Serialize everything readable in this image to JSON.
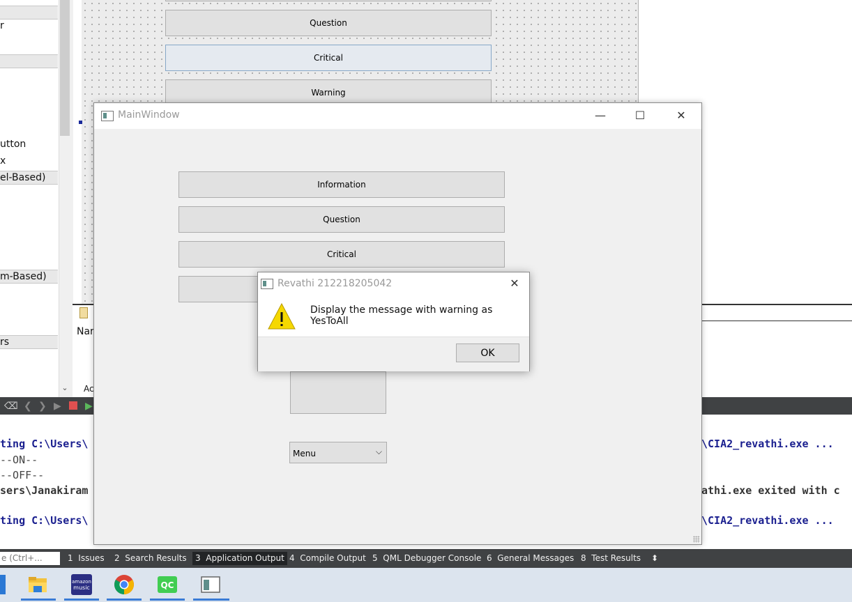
{
  "sidebar": {
    "line1": "r",
    "item_button": "utton",
    "item_x": "x",
    "category_item_based": "el-Based)",
    "category_item_model": "m-Based)",
    "category_containers": "rs"
  },
  "designer": {
    "buttons": [
      "Question",
      "Critical",
      "Warning"
    ]
  },
  "left_panel": {
    "name_label": "Nar",
    "ad_label": "Ac"
  },
  "console": {
    "lines": [
      "ting C:\\Users\\",
      "--ON--",
      "--OFF--",
      "sers\\Janakiram",
      "ting C:\\Users\\"
    ],
    "right_lines": [
      "\\CIA2_revathi.exe ...",
      "athi.exe exited with c",
      "\\CIA2_revathi.exe ..."
    ]
  },
  "statusbar": {
    "search_placeholder": "e (Ctrl+...",
    "tabs": [
      {
        "num": "1",
        "label": "Issues"
      },
      {
        "num": "2",
        "label": "Search Results"
      },
      {
        "num": "3",
        "label": "Application Output"
      },
      {
        "num": "4",
        "label": "Compile Output"
      },
      {
        "num": "5",
        "label": "QML Debugger Console"
      },
      {
        "num": "6",
        "label": "General Messages"
      },
      {
        "num": "8",
        "label": "Test Results"
      }
    ],
    "active_tab": 2,
    "arrows": "⬍"
  },
  "mainwindow": {
    "title": "MainWindow",
    "minimize": "—",
    "maximize": "☐",
    "close": "✕",
    "buttons": [
      "Information",
      "Question",
      "Critical"
    ],
    "combo_value": "Menu",
    "combo_arrow": "⌵"
  },
  "dialog": {
    "title": "Revathi 212218205042",
    "close": "✕",
    "message": "Display the message with warning as YesToAll",
    "ok_label": "OK",
    "icon": "warning-triangle-icon"
  },
  "taskbar": {
    "icons": [
      "file-explorer-icon",
      "amazon-music-icon",
      "chrome-icon",
      "qt-creator-icon",
      "qt-app-icon"
    ],
    "amazon_text": "amazon\nmusic",
    "qc_text": "QC"
  },
  "colors": {
    "accent": "#3a7bd5",
    "console_blue": "#1a1f8f",
    "warning_yellow": "#f5d800",
    "dark_panel": "#404244"
  }
}
